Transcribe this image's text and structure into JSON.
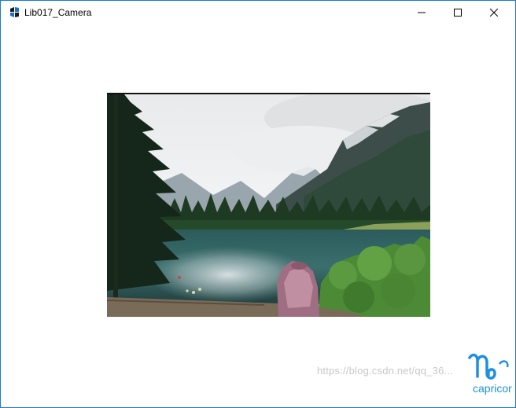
{
  "window": {
    "title": "Lib017_Camera",
    "controls": {
      "minimize_icon": "minimize-icon",
      "maximize_icon": "maximize-icon",
      "close_icon": "close-icon"
    },
    "accent_color": "#1a7ad4"
  },
  "camera_view": {
    "content": "camera-frame"
  },
  "watermark": {
    "text": "https://blog.csdn.net/qq_36...",
    "logo_text": "capricor"
  }
}
